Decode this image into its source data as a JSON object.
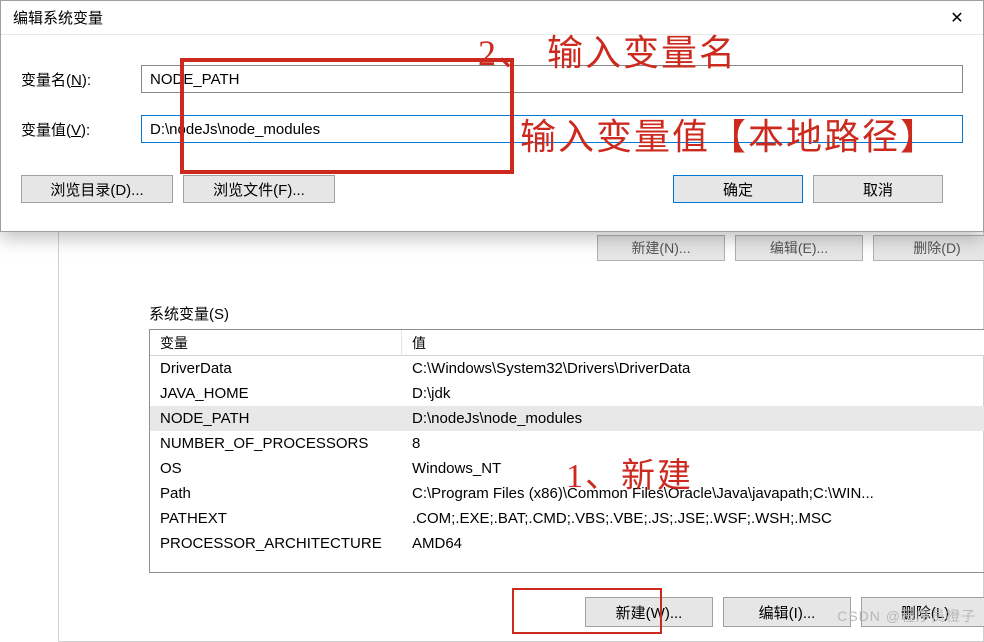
{
  "dialog": {
    "title": "编辑系统变量",
    "close": "✕",
    "name_label_pre": "变量名(",
    "name_label_u": "N",
    "name_label_post": "):",
    "value_label_pre": "变量值(",
    "value_label_u": "V",
    "value_label_post": "):",
    "name_value": "NODE_PATH",
    "value_value": "D:\\nodeJs\\node_modules",
    "browse_dir": "浏览目录(D)...",
    "browse_file": "浏览文件(F)...",
    "ok": "确定",
    "cancel": "取消"
  },
  "back": {
    "new_btn": "新建(N)...",
    "edit_btn": "编辑(E)...",
    "delete_btn": "删除(D)",
    "section": "系统变量(S)",
    "col_var": "变量",
    "col_val": "值",
    "rows": [
      {
        "var": "DriverData",
        "val": "C:\\Windows\\System32\\Drivers\\DriverData"
      },
      {
        "var": "JAVA_HOME",
        "val": "D:\\jdk"
      },
      {
        "var": "NODE_PATH",
        "val": "D:\\nodeJs\\node_modules"
      },
      {
        "var": "NUMBER_OF_PROCESSORS",
        "val": "8"
      },
      {
        "var": "OS",
        "val": "Windows_NT"
      },
      {
        "var": "Path",
        "val": "C:\\Program Files (x86)\\Common Files\\Oracle\\Java\\javapath;C:\\WIN..."
      },
      {
        "var": "PATHEXT",
        "val": ".COM;.EXE;.BAT;.CMD;.VBS;.VBE;.JS;.JSE;.WSF;.WSH;.MSC"
      },
      {
        "var": "PROCESSOR_ARCHITECTURE",
        "val": "AMD64"
      }
    ],
    "new2": "新建(W)...",
    "edit2": "编辑(I)...",
    "delete2": "删除(L)"
  },
  "annotations": {
    "a1": "1、新建",
    "a2": "2、 输入变量名",
    "a3": "输入变量值【本地路径】"
  },
  "watermark": "CSDN @程序员橙子"
}
